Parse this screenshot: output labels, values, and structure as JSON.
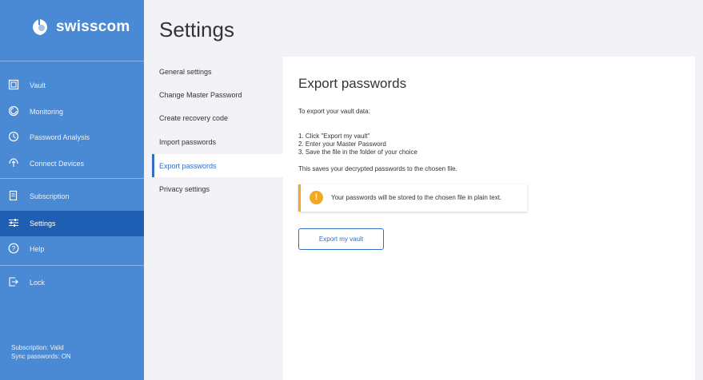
{
  "brand": {
    "name": "swisscom",
    "colors": {
      "sidebar": "#4a8ad4",
      "active": "#1f5fb3",
      "accent": "#2e6fc7",
      "warning": "#f5a623"
    }
  },
  "sidebar": {
    "items": [
      {
        "label": "Vault",
        "icon": "vault-icon"
      },
      {
        "label": "Monitoring",
        "icon": "monitoring-icon"
      },
      {
        "label": "Password Analysis",
        "icon": "password-analysis-icon"
      },
      {
        "label": "Connect Devices",
        "icon": "connect-devices-icon"
      },
      {
        "label": "Subscription",
        "icon": "subscription-icon"
      },
      {
        "label": "Settings",
        "icon": "settings-sliders-icon",
        "active": true
      },
      {
        "label": "Help",
        "icon": "help-icon"
      },
      {
        "label": "Lock",
        "icon": "lock-icon"
      }
    ],
    "status": {
      "subscription": "Subscription: Valid",
      "sync": "Sync passwords: ON"
    }
  },
  "page": {
    "title": "Settings"
  },
  "subnav": {
    "items": [
      {
        "label": "General settings"
      },
      {
        "label": "Change Master Password"
      },
      {
        "label": "Create recovery code"
      },
      {
        "label": "Import passwords"
      },
      {
        "label": "Export passwords",
        "active": true
      },
      {
        "label": "Privacy settings"
      }
    ]
  },
  "panel": {
    "title": "Export passwords",
    "intro": "To export your vault data:",
    "steps": [
      "1. Click \"Export my vault\"",
      "2. Enter your Master Password",
      "3. Save the file in the folder of your choice"
    ],
    "note": "This saves your decrypted passwords to the chosen file.",
    "warning": {
      "icon": "exclamation-icon",
      "glyph": "!",
      "text": "Your passwords will be stored to the chosen file in plain text."
    },
    "button_label": "Export my vault"
  }
}
